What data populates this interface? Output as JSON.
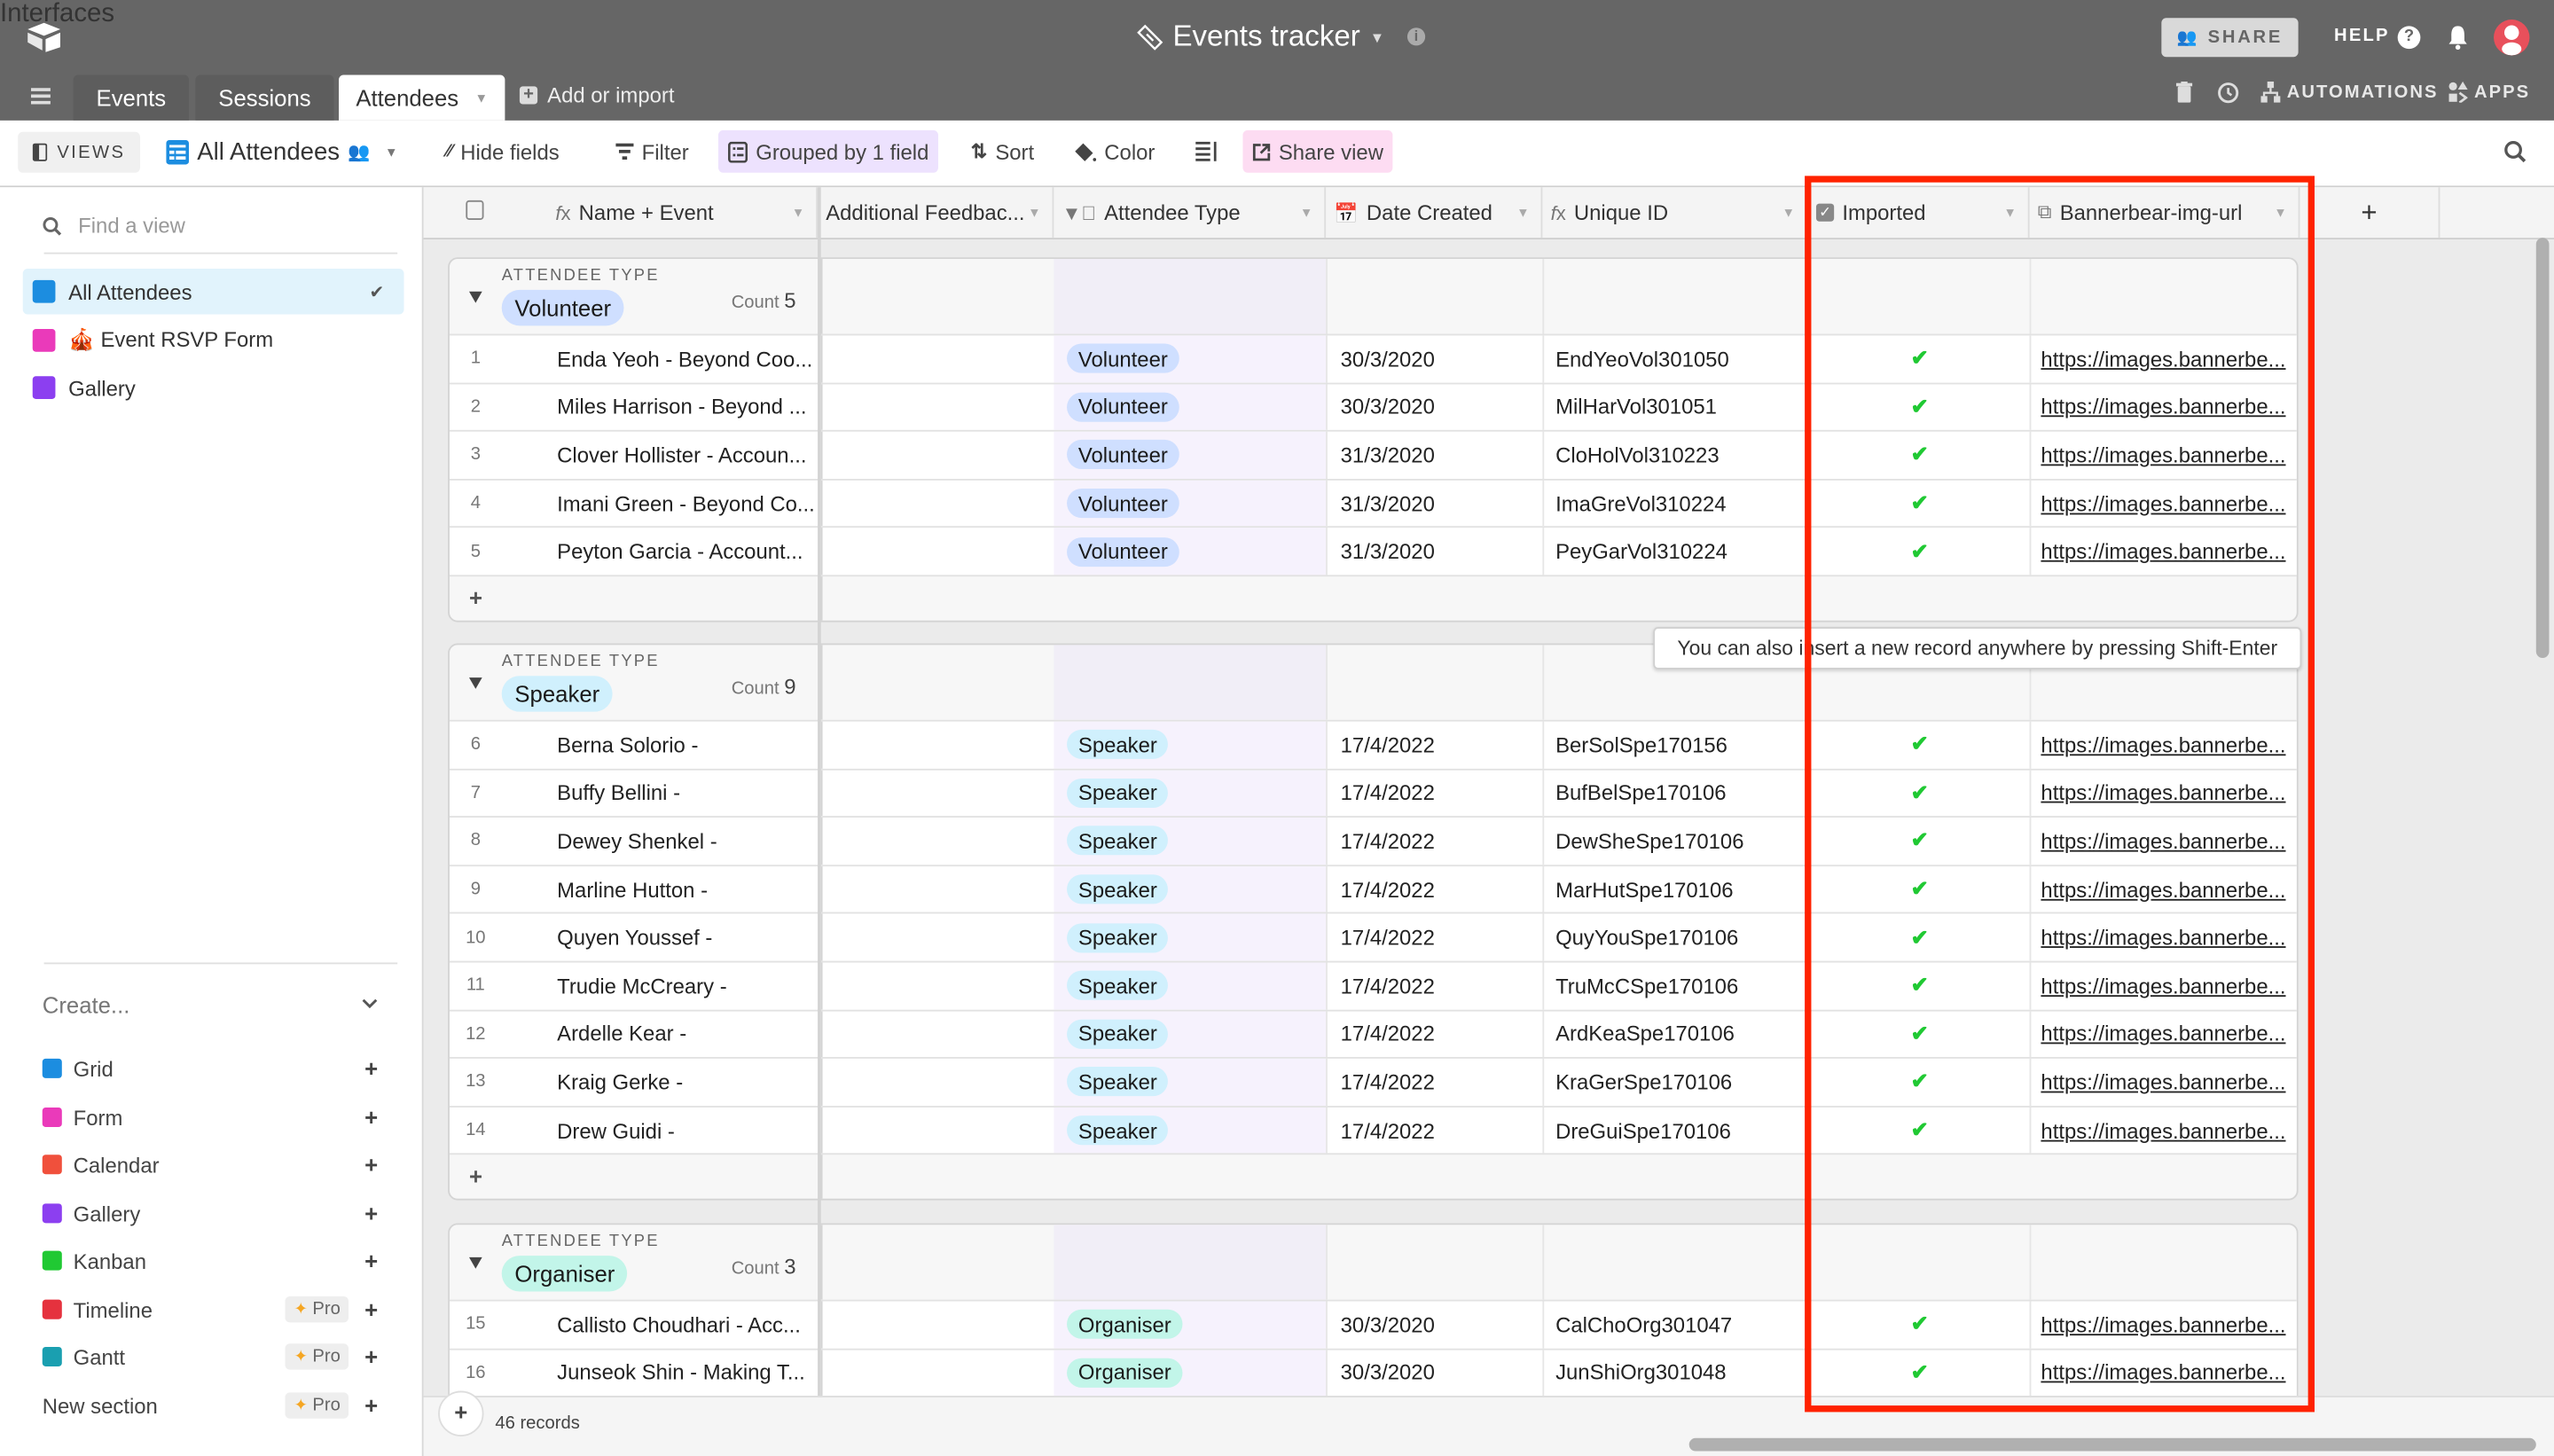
{
  "app": {
    "workspace_label": "Interfaces",
    "base_title": "Events tracker",
    "share_label": "SHARE",
    "help_label": "HELP",
    "automations_label": "AUTOMATIONS",
    "apps_label": "APPS"
  },
  "tables": {
    "tabs": [
      {
        "label": "Events",
        "active": false
      },
      {
        "label": "Sessions",
        "active": false
      },
      {
        "label": "Attendees",
        "active": true
      }
    ],
    "add_import_label": "Add or import"
  },
  "toolbar": {
    "views_label": "VIEWS",
    "current_view": "All Attendees",
    "hide_fields": "Hide fields",
    "filter": "Filter",
    "grouped": "Grouped by 1 field",
    "sort": "Sort",
    "color": "Color",
    "share_view": "Share view"
  },
  "sidebar": {
    "find_placeholder": "Find a view",
    "views": [
      {
        "label": "All Attendees",
        "icon": "grid-view-icon",
        "color": "#1c8de0",
        "selected": true
      },
      {
        "label": "🎪 Event RSVP Form",
        "icon": "form-view-icon",
        "color": "#ea3aba",
        "selected": false
      },
      {
        "label": "Gallery",
        "icon": "gallery-view-icon",
        "color": "#8c3ff0",
        "selected": false
      }
    ],
    "create_label": "Create...",
    "create_items": [
      {
        "label": "Grid",
        "icon": "grid-icon",
        "color": "#1c8de0",
        "pro": false
      },
      {
        "label": "Form",
        "icon": "form-icon",
        "color": "#ea3aba",
        "pro": false
      },
      {
        "label": "Calendar",
        "icon": "calendar-icon",
        "color": "#f0503c",
        "pro": false
      },
      {
        "label": "Gallery",
        "icon": "gallery-icon",
        "color": "#8c3ff0",
        "pro": false
      },
      {
        "label": "Kanban",
        "icon": "kanban-icon",
        "color": "#20c933",
        "pro": false
      },
      {
        "label": "Timeline",
        "icon": "timeline-icon",
        "color": "#e5323e",
        "pro": true
      },
      {
        "label": "Gantt",
        "icon": "gantt-icon",
        "color": "#1a9fb0",
        "pro": true
      },
      {
        "label": "New section",
        "icon": "",
        "color": "",
        "pro": true
      }
    ],
    "pro_label": "Pro"
  },
  "grid": {
    "columns": [
      {
        "label": "Name + Event",
        "icon": "formula-icon"
      },
      {
        "label": "Additional Feedbac...",
        "icon": ""
      },
      {
        "label": "Attendee Type",
        "icon": "single-select-icon"
      },
      {
        "label": "Date Created",
        "icon": "date-icon"
      },
      {
        "label": "Unique ID",
        "icon": "formula-icon"
      },
      {
        "label": "Imported",
        "icon": "checkbox-icon"
      },
      {
        "label": "Bannerbear-img-url",
        "icon": "url-icon"
      }
    ],
    "group_field_label": "ATTENDEE TYPE",
    "count_label": "Count",
    "groups": [
      {
        "name": "Volunteer",
        "count": "5",
        "color": "#cfdfff",
        "rows": [
          {
            "num": "1",
            "name": "Enda Yeoh - Beyond Coo...",
            "feedback": "",
            "type": "Volunteer",
            "date": "30/3/2020",
            "uid": "EndYeoVol301050",
            "imported": true,
            "url": "https://images.bannerbe..."
          },
          {
            "num": "2",
            "name": "Miles Harrison - Beyond ...",
            "feedback": "",
            "type": "Volunteer",
            "date": "30/3/2020",
            "uid": "MilHarVol301051",
            "imported": true,
            "url": "https://images.bannerbe..."
          },
          {
            "num": "3",
            "name": "Clover Hollister - Accoun...",
            "feedback": "",
            "type": "Volunteer",
            "date": "31/3/2020",
            "uid": "CloHolVol310223",
            "imported": true,
            "url": "https://images.bannerbe..."
          },
          {
            "num": "4",
            "name": "Imani Green - Beyond Co...",
            "feedback": "",
            "type": "Volunteer",
            "date": "31/3/2020",
            "uid": "ImaGreVol310224",
            "imported": true,
            "url": "https://images.bannerbe..."
          },
          {
            "num": "5",
            "name": "Peyton Garcia - Account...",
            "feedback": "",
            "type": "Volunteer",
            "date": "31/3/2020",
            "uid": "PeyGarVol310224",
            "imported": true,
            "url": "https://images.bannerbe..."
          }
        ]
      },
      {
        "name": "Speaker",
        "count": "9",
        "color": "#d0f0fd",
        "rows": [
          {
            "num": "6",
            "name": "Berna Solorio -",
            "feedback": "",
            "type": "Speaker",
            "date": "17/4/2022",
            "uid": "BerSolSpe170156",
            "imported": true,
            "url": "https://images.bannerbe..."
          },
          {
            "num": "7",
            "name": "Buffy Bellini -",
            "feedback": "",
            "type": "Speaker",
            "date": "17/4/2022",
            "uid": "BufBelSpe170106",
            "imported": true,
            "url": "https://images.bannerbe..."
          },
          {
            "num": "8",
            "name": "Dewey Shenkel -",
            "feedback": "",
            "type": "Speaker",
            "date": "17/4/2022",
            "uid": "DewSheSpe170106",
            "imported": true,
            "url": "https://images.bannerbe..."
          },
          {
            "num": "9",
            "name": "Marline Hutton -",
            "feedback": "",
            "type": "Speaker",
            "date": "17/4/2022",
            "uid": "MarHutSpe170106",
            "imported": true,
            "url": "https://images.bannerbe..."
          },
          {
            "num": "10",
            "name": "Quyen Youssef -",
            "feedback": "",
            "type": "Speaker",
            "date": "17/4/2022",
            "uid": "QuyYouSpe170106",
            "imported": true,
            "url": "https://images.bannerbe..."
          },
          {
            "num": "11",
            "name": "Trudie McCreary -",
            "feedback": "",
            "type": "Speaker",
            "date": "17/4/2022",
            "uid": "TruMcCSpe170106",
            "imported": true,
            "url": "https://images.bannerbe..."
          },
          {
            "num": "12",
            "name": "Ardelle Kear -",
            "feedback": "",
            "type": "Speaker",
            "date": "17/4/2022",
            "uid": "ArdKeaSpe170106",
            "imported": true,
            "url": "https://images.bannerbe..."
          },
          {
            "num": "13",
            "name": "Kraig Gerke -",
            "feedback": "",
            "type": "Speaker",
            "date": "17/4/2022",
            "uid": "KraGerSpe170106",
            "imported": true,
            "url": "https://images.bannerbe..."
          },
          {
            "num": "14",
            "name": "Drew Guidi -",
            "feedback": "",
            "type": "Speaker",
            "date": "17/4/2022",
            "uid": "DreGuiSpe170106",
            "imported": true,
            "url": "https://images.bannerbe..."
          }
        ]
      },
      {
        "name": "Organiser",
        "count": "3",
        "color": "#c2f5e9",
        "rows": [
          {
            "num": "15",
            "name": "Callisto Choudhari - Acc...",
            "feedback": "",
            "type": "Organiser",
            "date": "30/3/2020",
            "uid": "CalChoOrg301047",
            "imported": true,
            "url": "https://images.bannerbe..."
          },
          {
            "num": "16",
            "name": "Junseok Shin - Making T...",
            "feedback": "",
            "type": "Organiser",
            "date": "30/3/2020",
            "uid": "JunShiOrg301048",
            "imported": true,
            "url": "https://images.bannerbe..."
          }
        ]
      }
    ],
    "tooltip": "You can also insert a new record anywhere by pressing Shift-Enter",
    "record_count": "46 records"
  }
}
